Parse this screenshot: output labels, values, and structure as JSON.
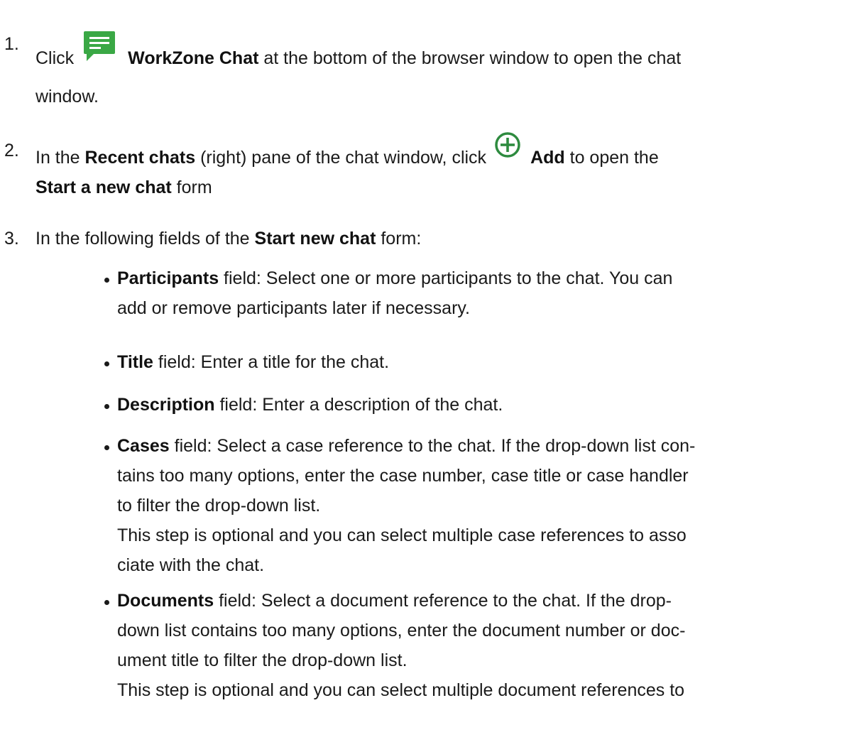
{
  "steps": [
    {
      "number": "1.",
      "prefix": "Click",
      "icon": "chat-icon",
      "strong": "WorkZone Chat",
      "rest_line1": " at the bottom of the browser window to open the chat",
      "line2": "window."
    },
    {
      "number": "2.",
      "prefix": "In the ",
      "strong1": "Recent chats",
      "mid1": " (right) pane of the chat window, click",
      "icon": "add-circle-icon",
      "strong2": "Add",
      "rest_line1": " to open the",
      "line2_strong": "Start a new chat",
      "line2_rest": " form"
    },
    {
      "number": "3.",
      "prefix": "In the following fields of the ",
      "strong": "Start new chat",
      "rest": " form:"
    }
  ],
  "bullets": [
    {
      "label": "Participants",
      "line1": " field: Select one or more participants to the chat. You can",
      "line2": "add or remove participants later if necessary."
    },
    {
      "label": "Title",
      "line1": " field: Enter a title for the chat."
    },
    {
      "label": "Description",
      "line1": " field: Enter a description of the chat."
    },
    {
      "label": "Cases",
      "line1": " field: Select a case reference to the chat. If the drop-down list con-",
      "line2": "tains too many options, enter the case number, case title or case handler",
      "line3": "to filter the drop-down list.",
      "line4": "This step is optional and you can select multiple case references to asso",
      "line5": "ciate with the chat."
    },
    {
      "label": "Documents",
      "line1": " field: Select a document reference to the chat. If the drop-",
      "line2": "down list contains too many options, enter the document number or doc-",
      "line3": "ument title to filter the drop-down list.",
      "line4": "This step is optional and you can select multiple document references to"
    }
  ],
  "colors": {
    "chat_icon": "#3aa845",
    "add_icon": "#2e8b3f",
    "text": "#1a1a1a"
  }
}
